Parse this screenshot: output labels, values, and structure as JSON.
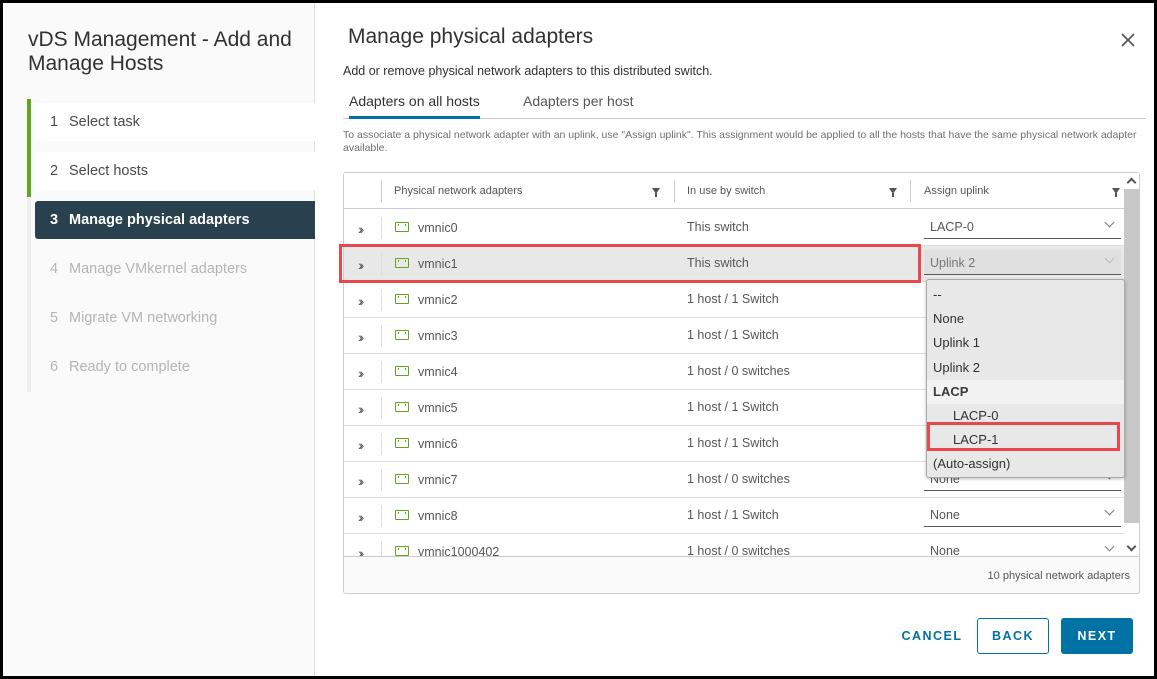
{
  "wizard": {
    "title": "vDS Management - Add and Manage Hosts",
    "steps": [
      {
        "num": "1",
        "label": "Select task",
        "state": "done"
      },
      {
        "num": "2",
        "label": "Select hosts",
        "state": "done"
      },
      {
        "num": "3",
        "label": "Manage physical adapters",
        "state": "active"
      },
      {
        "num": "4",
        "label": "Manage VMkernel adapters",
        "state": "pending"
      },
      {
        "num": "5",
        "label": "Migrate VM networking",
        "state": "pending"
      },
      {
        "num": "6",
        "label": "Ready to complete",
        "state": "pending"
      }
    ]
  },
  "page": {
    "title": "Manage physical adapters",
    "subtitle": "Add or remove physical network adapters to this distributed switch.",
    "close_icon": "close-icon",
    "tabs": [
      {
        "label": "Adapters on all hosts",
        "active": true
      },
      {
        "label": "Adapters per host",
        "active": false
      }
    ],
    "info": "To associate a physical network adapter with an uplink, use \"Assign uplink\". This assignment would be applied to all the hosts that have the same physical network adapter available."
  },
  "grid": {
    "columns": [
      "Physical network adapters",
      "In use by switch",
      "Assign uplink"
    ],
    "rows": [
      {
        "name": "vmnic0",
        "in_use": "This switch",
        "uplink": "LACP-0",
        "selected": false
      },
      {
        "name": "vmnic1",
        "in_use": "This switch",
        "uplink": "Uplink 2",
        "selected": true
      },
      {
        "name": "vmnic2",
        "in_use": "1 host / 1 Switch",
        "uplink": "",
        "selected": false
      },
      {
        "name": "vmnic3",
        "in_use": "1 host / 1 Switch",
        "uplink": "",
        "selected": false
      },
      {
        "name": "vmnic4",
        "in_use": "1 host / 0 switches",
        "uplink": "",
        "selected": false
      },
      {
        "name": "vmnic5",
        "in_use": "1 host / 1 Switch",
        "uplink": "",
        "selected": false
      },
      {
        "name": "vmnic6",
        "in_use": "1 host / 1 Switch",
        "uplink": "",
        "selected": false
      },
      {
        "name": "vmnic7",
        "in_use": "1 host / 0 switches",
        "uplink": "None",
        "selected": false
      },
      {
        "name": "vmnic8",
        "in_use": "1 host / 1 Switch",
        "uplink": "None",
        "selected": false
      },
      {
        "name": "vmnic1000402",
        "in_use": "1 host / 0 switches",
        "uplink": "None",
        "selected": false
      }
    ],
    "footer": "10 physical network adapters"
  },
  "dropdown": {
    "options": [
      {
        "label": "--",
        "type": "option"
      },
      {
        "label": "None",
        "type": "option"
      },
      {
        "label": "Uplink 1",
        "type": "option"
      },
      {
        "label": "Uplink 2",
        "type": "option"
      },
      {
        "label": "LACP",
        "type": "group"
      },
      {
        "label": "LACP-0",
        "type": "child"
      },
      {
        "label": "LACP-1",
        "type": "child",
        "highlighted": true
      },
      {
        "label": "(Auto-assign)",
        "type": "option"
      }
    ]
  },
  "buttons": {
    "cancel": "CANCEL",
    "back": "BACK",
    "next": "NEXT"
  },
  "colors": {
    "accent": "#0072a3",
    "active_step": "#29414e",
    "done_rail": "#62a420",
    "highlight": "#e8474d"
  }
}
